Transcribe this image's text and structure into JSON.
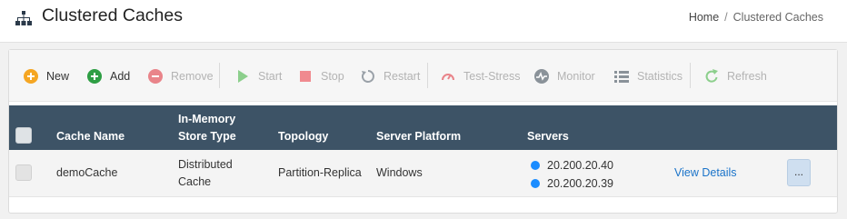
{
  "header": {
    "title": "Clustered Caches",
    "title_icon": "sitemap-icon"
  },
  "breadcrumb": {
    "home": "Home",
    "separator": "/",
    "current": "Clustered Caches"
  },
  "toolbar": {
    "new": "New",
    "add": "Add",
    "remove": "Remove",
    "start": "Start",
    "stop": "Stop",
    "restart": "Restart",
    "test_stress": "Test-Stress",
    "monitor": "Monitor",
    "statistics": "Statistics",
    "refresh": "Refresh"
  },
  "table": {
    "headers": {
      "cache_name": "Cache Name",
      "store_type_line1": "In-Memory",
      "store_type_line2": "Store Type",
      "topology": "Topology",
      "server_platform": "Server Platform",
      "servers": "Servers"
    },
    "rows": [
      {
        "cache_name": "demoCache",
        "store_type_line1": "Distributed",
        "store_type_line2": "Cache",
        "topology": "Partition-Replica",
        "server_platform": "Windows",
        "servers": [
          "20.200.20.40",
          "20.200.20.39"
        ],
        "view_details": "View Details",
        "more": "..."
      }
    ]
  },
  "colors": {
    "header_bg": "#3d5366",
    "server_dot": "#1a8cff",
    "link": "#1a73c9",
    "new_icon": "#f5a623",
    "add_icon": "#2e9e44",
    "remove_icon": "#e9848a",
    "start_icon": "#8ccf8c",
    "stop_icon": "#f08a8f"
  }
}
